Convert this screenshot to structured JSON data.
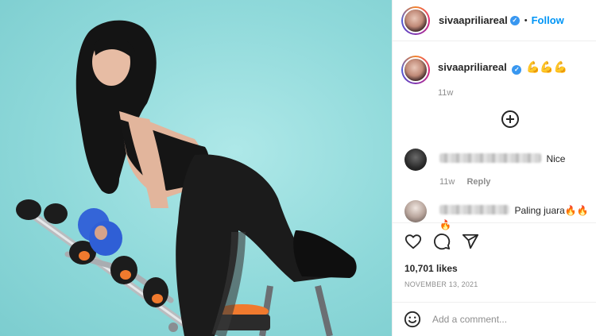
{
  "post": {
    "username": "sivaapriliareal",
    "follow_label": "Follow",
    "separator": "•",
    "caption_emoji": "💪💪💪",
    "caption_time": "11w",
    "likes": "10,701 likes",
    "date": "NOVEMBER 13, 2021",
    "add_comment_placeholder": "Add a comment..."
  },
  "comments": [
    {
      "text": "Nice",
      "time": "11w",
      "reply_label": "Reply"
    },
    {
      "text": "Paling juara🔥🔥🔥"
    }
  ],
  "icons": {
    "verified": "verified-badge-icon",
    "load_more": "plus-circle-icon",
    "like": "heart-icon",
    "comment": "comment-bubble-icon",
    "share": "paper-plane-icon",
    "emoji": "smiley-icon"
  },
  "colors": {
    "accent": "#0095f6",
    "verified": "#3897f0",
    "photo_background": "#8fd9da"
  }
}
